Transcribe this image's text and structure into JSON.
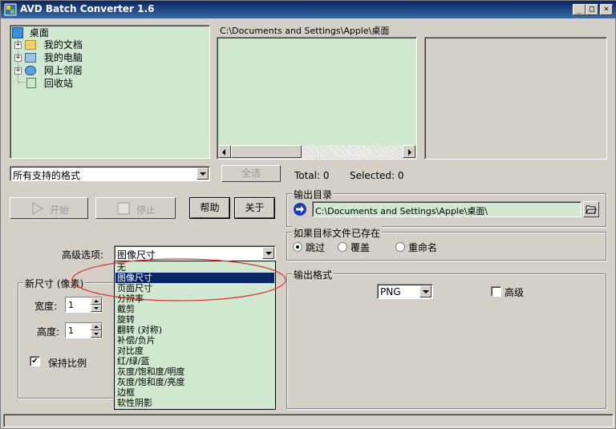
{
  "window": {
    "title": "AVD Batch Converter 1.6"
  },
  "tree": {
    "root": "桌面",
    "items": [
      {
        "label": "我的文档",
        "expandable": true
      },
      {
        "label": "我的电脑",
        "expandable": true
      },
      {
        "label": "网上邻居",
        "expandable": true
      },
      {
        "label": "回收站",
        "expandable": false
      }
    ]
  },
  "file_list": {
    "path": "C:\\Documents and Settings\\Apple\\桌面"
  },
  "filter": {
    "selected": "所有支持的格式",
    "select_all_label": "全选"
  },
  "counts": {
    "total": "Total: 0",
    "selected": "Selected: 0"
  },
  "actions": {
    "start": "开始",
    "stop": "停止",
    "help": "帮助",
    "about": "关于"
  },
  "output_dir": {
    "group_label": "输出目录",
    "path": "C:\\Documents and Settings\\Apple\\桌面\\"
  },
  "exists": {
    "group_label": "如果目标文件已存在",
    "options": [
      "跳过",
      "覆盖",
      "重命名"
    ],
    "selected_index": 0
  },
  "advanced": {
    "label": "高级选项:",
    "selected": "图像尺寸",
    "options": [
      "无",
      "图像尺寸",
      "页面尺寸",
      "分辨率",
      "截剪",
      "旋转",
      "翻转 (对称)",
      "补偿/负片",
      "对比度",
      "红/绿/蓝",
      "灰度/饱和度/明度",
      "灰度/饱和度/亮度",
      "边框",
      "软性阴影"
    ],
    "highlighted_index": 1
  },
  "new_size": {
    "group_label": "新尺寸 (像素)",
    "width_label": "宽度:",
    "width_value": "1",
    "height_label": "高度:",
    "height_value": "1",
    "keep_ratio_label": "保持比例",
    "keep_ratio": true
  },
  "output_format": {
    "group_label": "输出格式",
    "format": "PNG",
    "advanced_label": "高级",
    "advanced_checked": false
  },
  "colors": {
    "panel_green": "#cfe8cf",
    "highlight": "#0a246a",
    "annotation": "#e03030"
  }
}
